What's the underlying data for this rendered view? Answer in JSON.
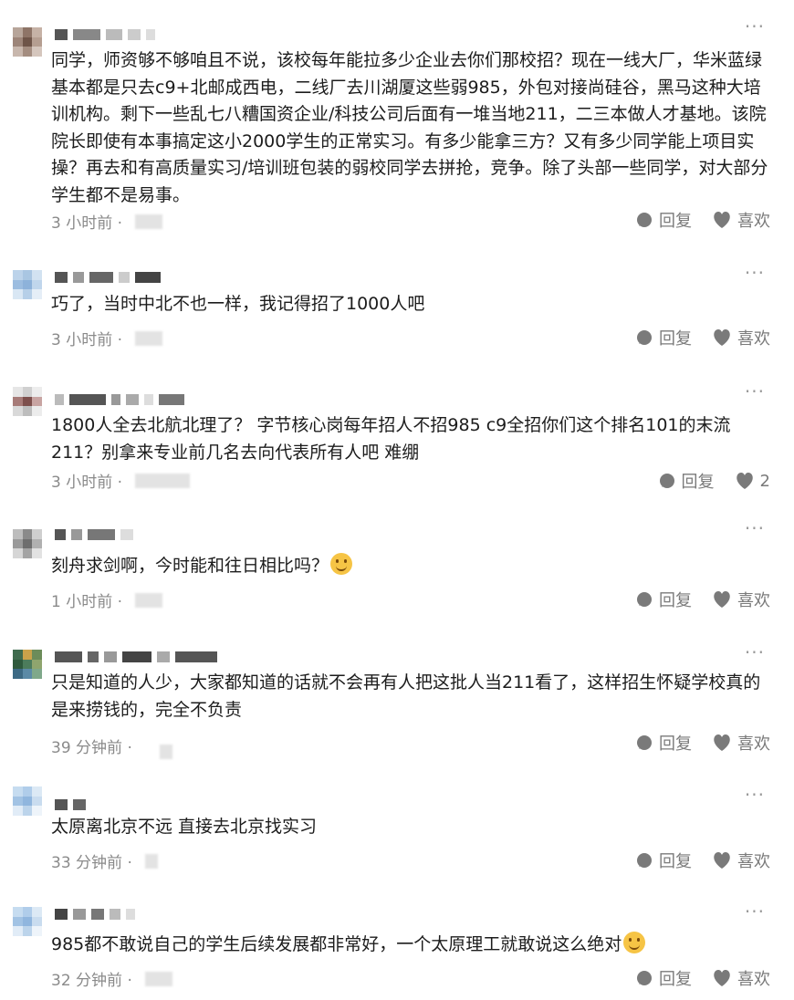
{
  "comments": [
    {
      "text": "同学，师资够不够咱且不说，该校每年能拉多少企业去你们那校招？现在一线大厂，华米蓝绿基本都是只去c9+北邮成西电，二线厂去川湖厦这些弱985，外包对接尚硅谷，黑马这种大培训机构。剩下一些乱七八糟国资企业/科技公司后面有一堆当地211，二三本做人才基地。该院院长即使有本事搞定这小2000学生的正常实习。有多少能拿三方？又有多少同学能上项目实操？再去和有高质量实习/培训班包装的弱校同学去拼抢，竞争。除了头部一些同学，对大部分学生都不是易事。",
      "time": "3 小时前 ·",
      "reply": "回复",
      "like": "喜欢"
    },
    {
      "text": "巧了，当时中北不也一样，我记得招了1000人吧",
      "time": "3 小时前 ·",
      "reply": "回复",
      "like": "喜欢"
    },
    {
      "text": "1800人全去北航北理了？ 字节核心岗每年招人不招985 c9全招你们这个排名101的末流211？别拿来专业前几名去向代表所有人吧 难绷",
      "time": "3 小时前 ·",
      "reply": "回复",
      "like": "2"
    },
    {
      "text": "刻舟求剑啊，今时能和往日相比吗？",
      "time": "1 小时前 ·",
      "reply": "回复",
      "like": "喜欢"
    },
    {
      "text": "只是知道的人少，大家都知道的话就不会再有人把这批人当211看了，这样招生怀疑学校真的是来捞钱的，完全不负责",
      "time": "39 分钟前 ·",
      "reply": "回复",
      "like": "喜欢"
    },
    {
      "text": "太原离北京不远 直接去北京找实习",
      "time": "33 分钟前 ·",
      "reply": "回复",
      "like": "喜欢"
    },
    {
      "text": "985都不敢说自己的学生后续发展都非常好，一个太原理工就敢说这么绝对",
      "time": "32 分钟前 ·",
      "reply": "回复",
      "like": "喜欢"
    }
  ],
  "icons": {
    "more": "more-dots-icon",
    "reply": "reply-bubble-icon",
    "like": "heart-icon",
    "emoji_thinking": "thinking-emoji-icon",
    "emoji_smile": "smile-emoji-icon"
  },
  "colors": {
    "text": "#1c1c1c",
    "meta": "#8a8a8a",
    "icon": "#7a7a7a"
  }
}
